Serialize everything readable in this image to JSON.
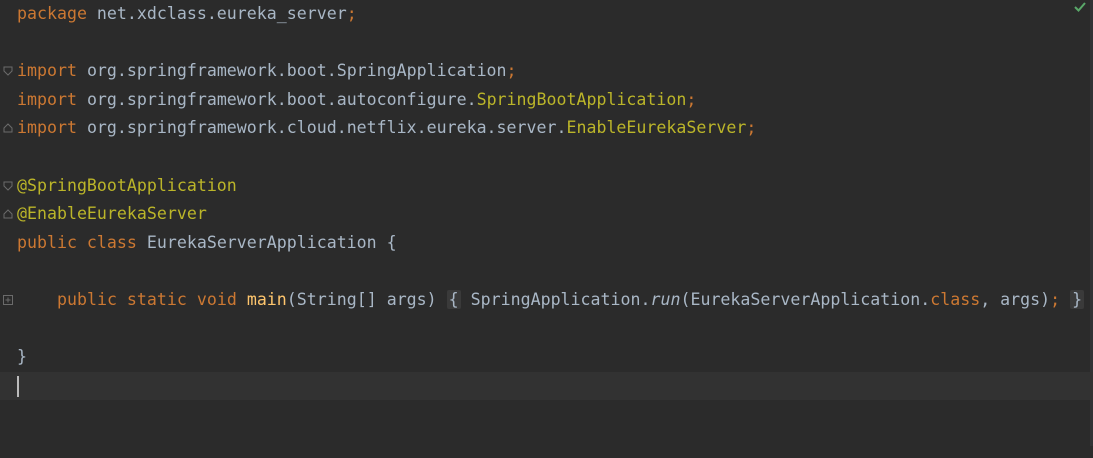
{
  "editor": {
    "language": "java",
    "status_icon": "check-icon",
    "colors": {
      "background": "#2b2b2b",
      "keyword": "#cc7832",
      "annotation": "#bbb529",
      "method": "#ffc66d",
      "plain": "#a9b7c6",
      "status_ok": "#59a869"
    },
    "lines": {
      "l1": {
        "kw": "package",
        "rest": " net.xdclass.eureka_server",
        "semi": ";"
      },
      "l3": {
        "kw": "import",
        "rest": " org.springframework.boot.SpringApplication",
        "semi": ";"
      },
      "l4": {
        "kw": "import",
        "rest": " org.springframework.boot.autoconfigure.",
        "cls": "SpringBootApplication",
        "semi": ";"
      },
      "l5": {
        "kw": "import",
        "rest": " org.springframework.cloud.netflix.eureka.server.",
        "cls": "EnableEurekaServer",
        "semi": ";"
      },
      "l7": {
        "ann": "@SpringBootApplication"
      },
      "l8": {
        "ann": "@EnableEurekaServer"
      },
      "l9": {
        "kw": "public class",
        "rest": " EurekaServerApplication {"
      },
      "l11": {
        "kw": "public static void",
        "fn": "main",
        "params": "(String[] args)",
        "open": "{",
        "call": " SpringApplication.",
        "method": "run",
        "args1": "(EurekaServerApplication.",
        "kw2": "class",
        "args2": ", args)",
        "semi": ";",
        "close": "}"
      },
      "l13": {
        "rest": "}"
      }
    }
  }
}
